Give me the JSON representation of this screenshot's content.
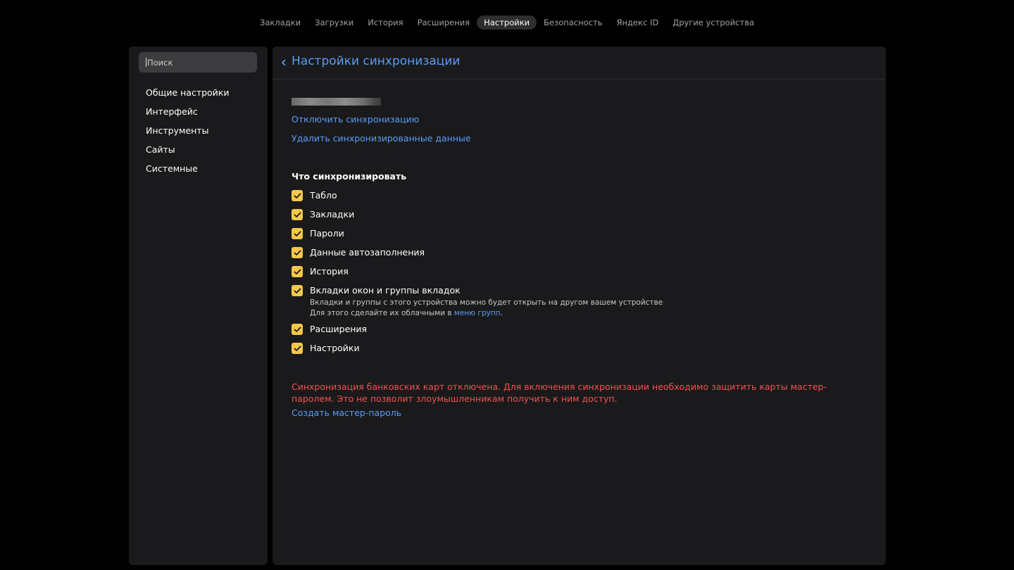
{
  "top_nav": {
    "tabs": [
      {
        "label": "Закладки",
        "active": false
      },
      {
        "label": "Загрузки",
        "active": false
      },
      {
        "label": "История",
        "active": false
      },
      {
        "label": "Расширения",
        "active": false
      },
      {
        "label": "Настройки",
        "active": true
      },
      {
        "label": "Безопасность",
        "active": false
      },
      {
        "label": "Яндекс ID",
        "active": false
      },
      {
        "label": "Другие устройства",
        "active": false
      }
    ]
  },
  "sidebar": {
    "search": {
      "placeholder": "Поиск",
      "value": ""
    },
    "items": [
      {
        "label": "Общие настройки"
      },
      {
        "label": "Интерфейс"
      },
      {
        "label": "Инструменты"
      },
      {
        "label": "Сайты"
      },
      {
        "label": "Системные"
      }
    ]
  },
  "main": {
    "back_icon": "chevron-left-icon",
    "title": "Настройки синхронизации",
    "disable_sync_link": "Отключить синхронизацию",
    "delete_data_link": "Удалить синхронизированные данные",
    "section_title": "Что синхронизировать",
    "sync_items": [
      {
        "label": "Табло",
        "checked": true
      },
      {
        "label": "Закладки",
        "checked": true
      },
      {
        "label": "Пароли",
        "checked": true
      },
      {
        "label": "Данные автозаполнения",
        "checked": true
      },
      {
        "label": "История",
        "checked": true
      },
      {
        "label": "Вкладки окон и группы вкладок",
        "checked": true,
        "hint_line1": "Вкладки и группы с этого устройства можно будет открыть на другом вашем устройстве",
        "hint_line2_prefix": "Для этого сделайте их облачными в",
        "hint_link": "меню групп",
        "hint_suffix": "."
      },
      {
        "label": "Расширения",
        "checked": true
      },
      {
        "label": "Настройки",
        "checked": true
      }
    ],
    "warning": "Синхронизация банковских карт отключена. Для включения синхронизации необходимо защитить карты мастер-паролем. Это не позволит злоумышленникам получить к ним доступ.",
    "create_master_password_link": "Создать мастер-пароль"
  },
  "colors": {
    "background": "#000000",
    "panel": "#1a1a1c",
    "link": "#5c9cf4",
    "checkbox": "#f4c84a",
    "warning": "#ef5350",
    "active_tab_bg": "#2e2e2e"
  }
}
